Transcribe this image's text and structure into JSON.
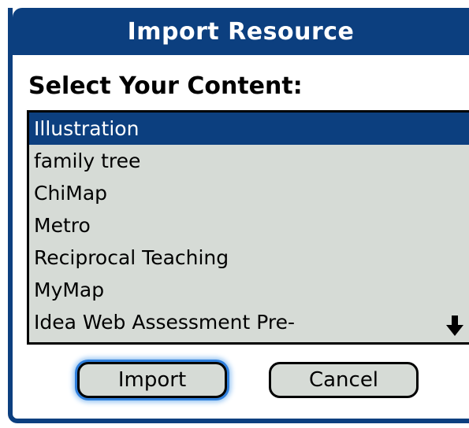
{
  "dialog": {
    "title": "Import Resource",
    "prompt": "Select Your Content:"
  },
  "list": {
    "items": [
      {
        "label": "Illustration",
        "selected": true
      },
      {
        "label": "family tree",
        "selected": false
      },
      {
        "label": "ChiMap",
        "selected": false
      },
      {
        "label": "Metro",
        "selected": false
      },
      {
        "label": "Reciprocal Teaching",
        "selected": false
      },
      {
        "label": "MyMap",
        "selected": false
      },
      {
        "label": "Idea Web Assessment Pre-",
        "selected": false
      }
    ],
    "scroll_icon": "arrow-down-icon"
  },
  "buttons": {
    "import_label": "Import",
    "cancel_label": "Cancel"
  },
  "colors": {
    "title_bar": "#0c3f7f",
    "selection": "#0c3f7f",
    "list_background": "#d6dbd6",
    "focus_ring": "#2f7fdc"
  }
}
